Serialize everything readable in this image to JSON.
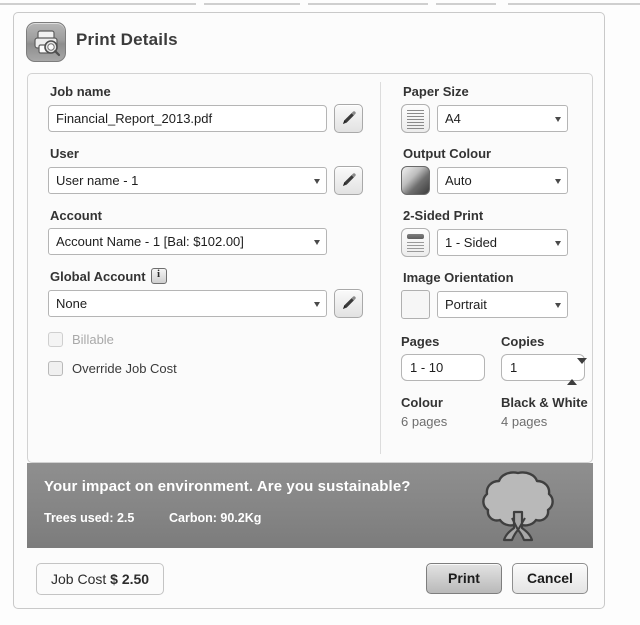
{
  "window": {
    "title": "Print Details",
    "app_icon": "printer-search-icon"
  },
  "left_column": {
    "job_name": {
      "label": "Job name",
      "value": "Financial_Report_2013.pdf",
      "edit_icon": "pencil-icon"
    },
    "user": {
      "label": "User",
      "value": "User name - 1",
      "edit_icon": "pencil-icon"
    },
    "account": {
      "label": "Account",
      "value": "Account Name - 1  [Bal: $102.00]"
    },
    "global_account": {
      "label": "Global Account",
      "info_icon": "info-icon",
      "value": "None",
      "edit_icon": "pencil-icon"
    },
    "billable": {
      "label": "Billable",
      "checked": false,
      "enabled": false
    },
    "override_job_cost": {
      "label": "Override Job Cost",
      "checked": false,
      "enabled": true
    }
  },
  "right_column": {
    "paper_size": {
      "label": "Paper Size",
      "value": "A4",
      "icon": "paper-lines-icon"
    },
    "output_colour": {
      "label": "Output Colour",
      "value": "Auto",
      "icon": "colour-swatch-icon"
    },
    "two_sided_print": {
      "label": "2-Sided Print",
      "value": "1 - Sided",
      "icon": "duplex-icon"
    },
    "image_orientation": {
      "label": "Image Orientation",
      "value": "Portrait",
      "icon": "portrait-page-icon"
    },
    "pages": {
      "label": "Pages",
      "value": "1 - 10"
    },
    "copies": {
      "label": "Copies",
      "value": "1",
      "stepper_icon": "up-down-arrows-icon"
    },
    "colour_count": {
      "label": "Colour",
      "value": "6 pages"
    },
    "bw_count": {
      "label": "Black & White",
      "value": "4 pages"
    }
  },
  "eco_banner": {
    "headline": "Your impact on environment. Are you sustainable?",
    "trees": "Trees used: 2.5",
    "carbon": "Carbon: 90.2Kg",
    "icon": "tree-icon",
    "background_color": "#868686"
  },
  "footer": {
    "job_cost_label": "Job Cost",
    "job_cost_value": "$ 2.50",
    "print_label": "Print",
    "cancel_label": "Cancel"
  }
}
